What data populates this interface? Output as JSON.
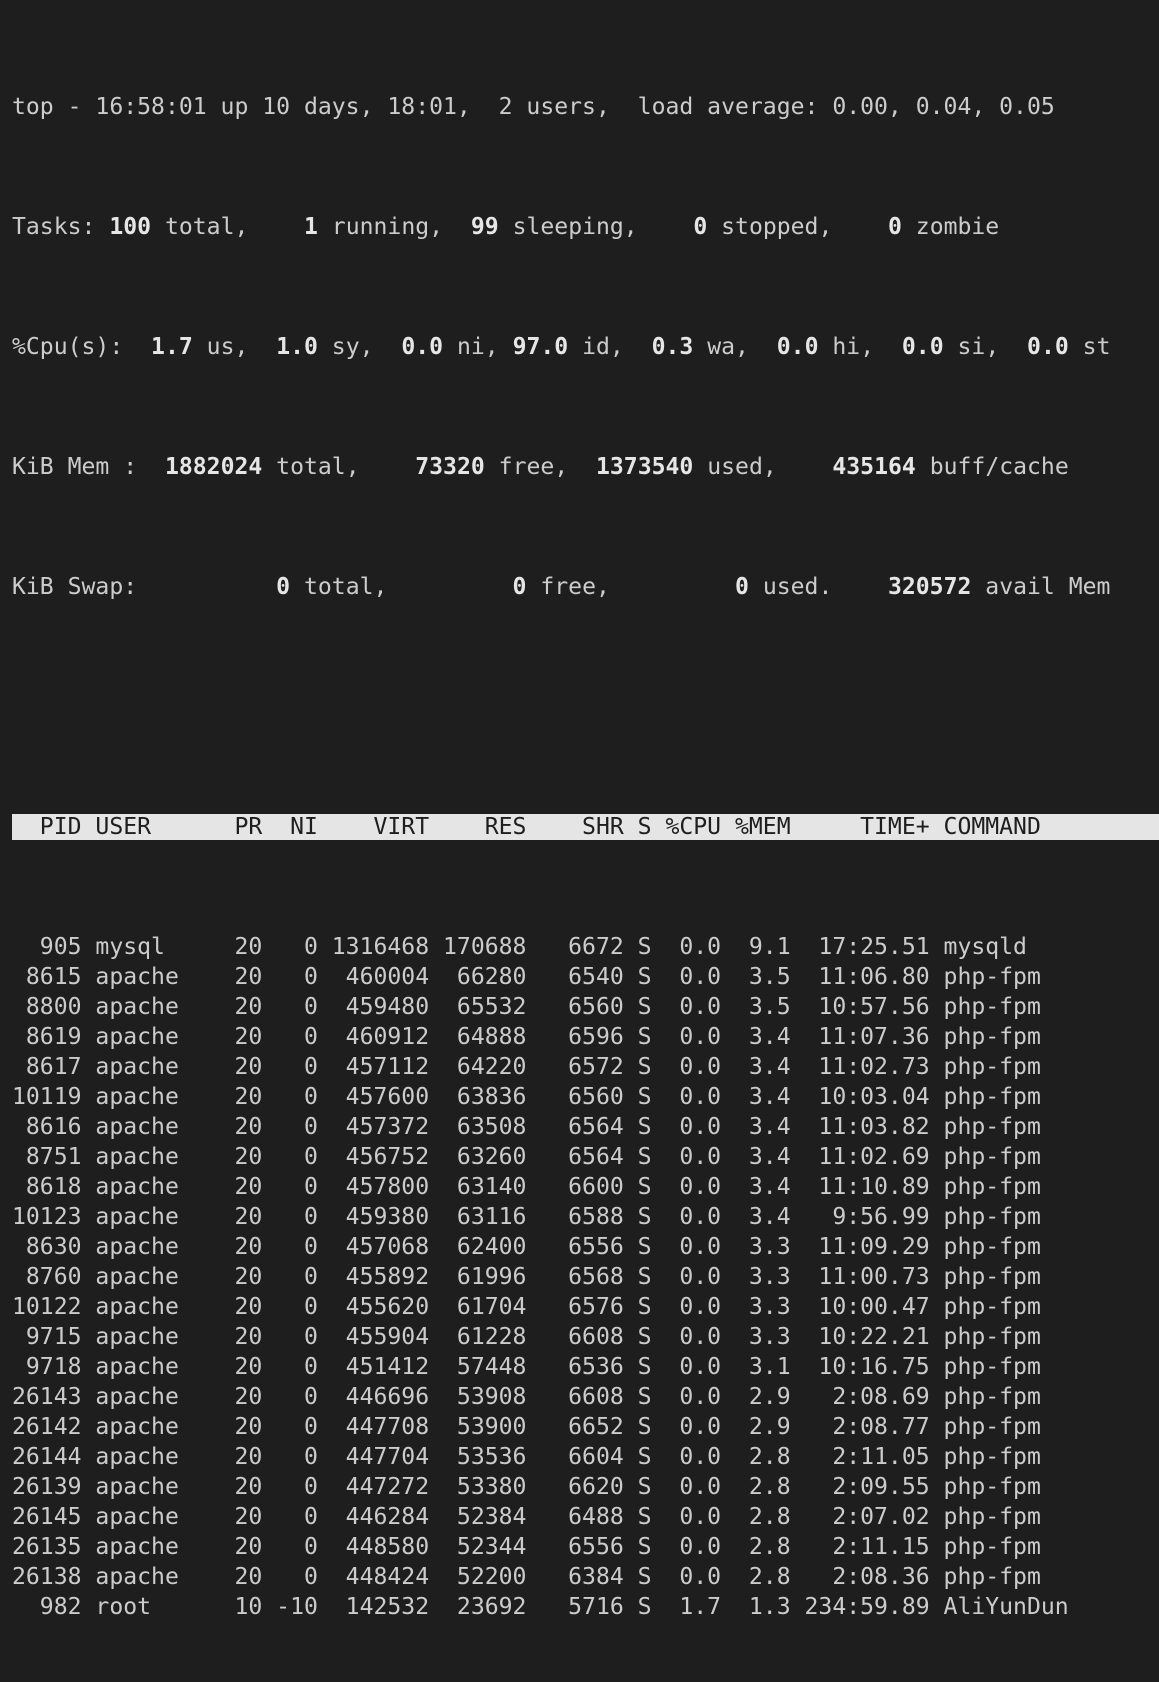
{
  "summary": {
    "line1": {
      "prefix": "top - 16:58:01 up 10 days, 18:01,  2 users,  load average: 0.00, 0.04, 0.05"
    },
    "tasks": {
      "label": "Tasks: ",
      "total": "100",
      "total_label": " total,    ",
      "running": "1",
      "running_label": " running,  ",
      "sleeping": "99",
      "sleeping_label": " sleeping,    ",
      "stopped": "0",
      "stopped_label": " stopped,    ",
      "zombie": "0",
      "zombie_label": " zombie"
    },
    "cpu": {
      "label": "%Cpu(s):  ",
      "us": "1.7",
      "us_label": " us,  ",
      "sy": "1.0",
      "sy_label": " sy,  ",
      "ni": "0.0",
      "ni_label": " ni, ",
      "id": "97.0",
      "id_label": " id,  ",
      "wa": "0.3",
      "wa_label": " wa,  ",
      "hi": "0.0",
      "hi_label": " hi,  ",
      "si": "0.0",
      "si_label": " si,  ",
      "st": "0.0",
      "st_label": " st"
    },
    "mem": {
      "label": "KiB Mem :  ",
      "total": "1882024",
      "total_label": " total,    ",
      "free": "73320",
      "free_label": " free,  ",
      "used": "1373540",
      "used_label": " used,    ",
      "buff": "435164",
      "buff_label": " buff/cache"
    },
    "swap": {
      "label": "KiB Swap:          ",
      "total": "0",
      "total_label": " total,         ",
      "free": "0",
      "free_label": " free,         ",
      "used": "0",
      "used_label": " used.    ",
      "avail": "320572",
      "avail_label": " avail Mem"
    }
  },
  "table": {
    "header": "  PID USER      PR  NI    VIRT    RES    SHR S %CPU %MEM     TIME+ COMMAND",
    "rows": [
      "  905 mysql     20   0 1316468 170688   6672 S  0.0  9.1  17:25.51 mysqld",
      " 8615 apache    20   0  460004  66280   6540 S  0.0  3.5  11:06.80 php-fpm",
      " 8800 apache    20   0  459480  65532   6560 S  0.0  3.5  10:57.56 php-fpm",
      " 8619 apache    20   0  460912  64888   6596 S  0.0  3.4  11:07.36 php-fpm",
      " 8617 apache    20   0  457112  64220   6572 S  0.0  3.4  11:02.73 php-fpm",
      "10119 apache    20   0  457600  63836   6560 S  0.0  3.4  10:03.04 php-fpm",
      " 8616 apache    20   0  457372  63508   6564 S  0.0  3.4  11:03.82 php-fpm",
      " 8751 apache    20   0  456752  63260   6564 S  0.0  3.4  11:02.69 php-fpm",
      " 8618 apache    20   0  457800  63140   6600 S  0.0  3.4  11:10.89 php-fpm",
      "10123 apache    20   0  459380  63116   6588 S  0.0  3.4   9:56.99 php-fpm",
      " 8630 apache    20   0  457068  62400   6556 S  0.0  3.3  11:09.29 php-fpm",
      " 8760 apache    20   0  455892  61996   6568 S  0.0  3.3  11:00.73 php-fpm",
      "10122 apache    20   0  455620  61704   6576 S  0.0  3.3  10:00.47 php-fpm",
      " 9715 apache    20   0  455904  61228   6608 S  0.0  3.3  10:22.21 php-fpm",
      " 9718 apache    20   0  451412  57448   6536 S  0.0  3.1  10:16.75 php-fpm",
      "26143 apache    20   0  446696  53908   6608 S  0.0  2.9   2:08.69 php-fpm",
      "26142 apache    20   0  447708  53900   6652 S  0.0  2.9   2:08.77 php-fpm",
      "26144 apache    20   0  447704  53536   6604 S  0.0  2.8   2:11.05 php-fpm",
      "26139 apache    20   0  447272  53380   6620 S  0.0  2.8   2:09.55 php-fpm",
      "26145 apache    20   0  446284  52384   6488 S  0.0  2.8   2:07.02 php-fpm",
      "26135 apache    20   0  448580  52344   6556 S  0.0  2.8   2:11.15 php-fpm",
      "26138 apache    20   0  448424  52200   6384 S  0.0  2.8   2:08.36 php-fpm",
      "  982 root      10 -10  142532  23692   5716 S  1.7  1.3 234:59.89 AliYunDun"
    ]
  },
  "colors": {
    "background": "#1e1e1e",
    "text": "#cccccc",
    "header_bar": "#e5e5e5"
  }
}
